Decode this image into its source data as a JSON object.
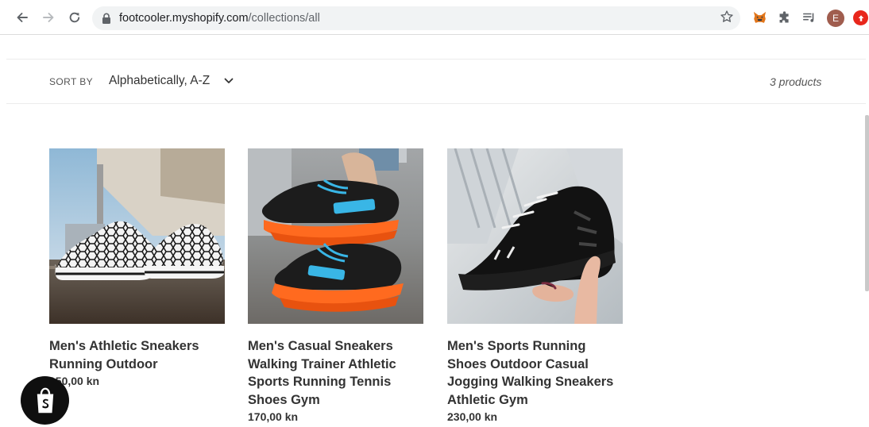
{
  "browser": {
    "url_host": "footcooler.myshopify.com",
    "url_path": "/collections/all",
    "profile_initial": "E",
    "icons": [
      "back-arrow-icon",
      "forward-arrow-icon",
      "reload-icon",
      "lock-icon",
      "star-icon",
      "metamask-fox-icon",
      "puzzle-extensions-icon",
      "media-queue-icon",
      "profile-avatar",
      "adblock-icon"
    ]
  },
  "collection": {
    "sort_label": "SORT BY",
    "sort_value": "Alphabetically, A-Z",
    "product_count": "3 products"
  },
  "products": [
    {
      "title": "Men's Athletic Sneakers Running Outdoor",
      "price": "150,00 kn"
    },
    {
      "title": "Men's Casual Sneakers Walking Trainer Athletic Sports Running Tennis Shoes Gym",
      "price": "170,00 kn"
    },
    {
      "title": "Men's Sports Running Shoes Outdoor Casual Jogging Walking Sneakers Athletic Gym",
      "price": "230,00 kn"
    }
  ],
  "colors": {
    "accent_orange": "#ff6a1f",
    "accent_cyan": "#39b6e6",
    "shopify_badge": "#0f0f0f"
  }
}
